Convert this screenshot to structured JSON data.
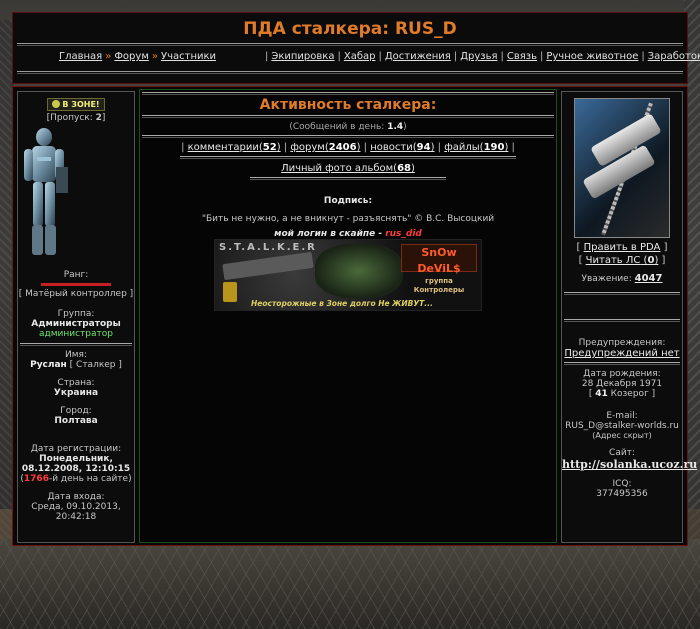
{
  "header": {
    "title": "ПДА сталкера: RUS_D",
    "nav_left": [
      {
        "label": "Главная"
      },
      {
        "label": "Форум"
      },
      {
        "label": "Участники"
      }
    ],
    "nav_left_separator": "»",
    "nav_right": [
      {
        "label": "Экипировка"
      },
      {
        "label": "Хабар"
      },
      {
        "label": "Достижения"
      },
      {
        "label": "Друзья"
      },
      {
        "label": "Связь"
      },
      {
        "label": "Ручное животное"
      },
      {
        "label": "Заработок"
      }
    ],
    "nav_right_separator": "|"
  },
  "left": {
    "status_badge": "В ЗОНЕ!",
    "pass_label": "[Пропуск:",
    "pass_value": "2",
    "pass_close": "]",
    "rank_label": "Ранг:",
    "rank_value": "[ Матёрый контроллер ]",
    "group_label": "Группа:",
    "group_value": "Администраторы",
    "group_sub": "администратор",
    "name_label": "Имя:",
    "name_value": "Руслан",
    "name_extra": "[ Сталкер ]",
    "country_label": "Страна:",
    "country_value": "Украина",
    "city_label": "Город:",
    "city_value": "Полтава",
    "reg_label": "Дата регистрации:",
    "reg_value_1": "Понедельник,",
    "reg_value_2": "08.12.2008, 12:10:15",
    "reg_days_open": "(",
    "reg_days": "1766",
    "reg_days_text": "-й день на сайте)",
    "login_label": "Дата входа:",
    "login_value_1": "Среда, 09.10.2013,",
    "login_value_2": "20:42:18"
  },
  "middle": {
    "title": "Активность сталкера:",
    "per_day_label": "(Сообщений в день:",
    "per_day_value": "1.4",
    "per_day_close": ")",
    "stats": [
      {
        "label": "комментарии",
        "value": "52"
      },
      {
        "label": "форум",
        "value": "2406"
      },
      {
        "label": "новости",
        "value": "94"
      },
      {
        "label": "файлы",
        "value": "190"
      }
    ],
    "album_label": "Личный фото альбом",
    "album_value": "68",
    "signature_label": "Подпись:",
    "signature_quote": "\"Бить не нужно, а не вникнут - разъяснять\" © В.С. Высоцкий",
    "skype_text": "мой логин в скайпе - ",
    "skype_login": "rus_did",
    "banner": {
      "stalker": "S.T.A.L.K.E.R",
      "logo_main": "SnOw DeViL$",
      "logo_sub": "группа Контролеры",
      "caption": "Неосторожные в Зоне долго Не ЖИВУТ..."
    }
  },
  "right": {
    "edit_pda_open": "[",
    "edit_pda": "Править в PDA",
    "edit_pda_close": "]",
    "read_ls_open": "[",
    "read_ls": "Читать ЛС",
    "read_ls_value": "0",
    "read_ls_close": "]",
    "respect_label": "Уважение:",
    "respect_value": "4047",
    "warnings_label": "Предупреждения:",
    "warnings_value": "Предупреждений нет",
    "birth_label": "Дата рождения:",
    "birth_value": "28 Декабря 1971",
    "birth_age_open": "[",
    "birth_age": "41",
    "birth_zodiac": "Козерог ]",
    "email_label": "E-mail:",
    "email_value": "RUS_D@stalker-worlds.ru",
    "email_note": "(Адрес скрыт)",
    "site_label": "Сайт:",
    "site_value": "http://solanka.ucoz.ru",
    "icq_label": "ICQ:",
    "icq_value": "377495356"
  },
  "colors": {
    "accent_orange": "#e07b2a",
    "green_text": "#6fe26f",
    "red_text": "#ff3a3a",
    "frame_red": "#8a1a1a"
  }
}
